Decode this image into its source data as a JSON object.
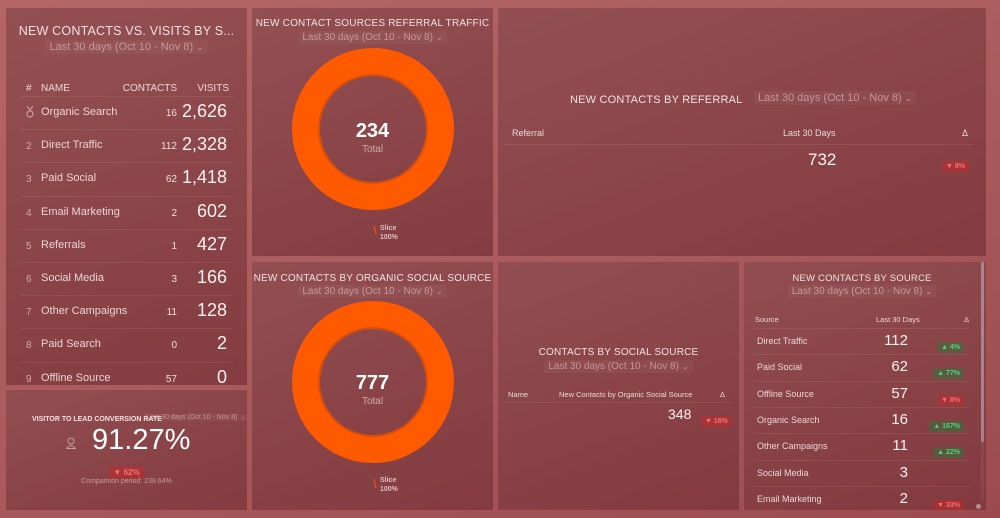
{
  "colors": {
    "background": "#b06262",
    "donut": "#ff5a00",
    "donut_inner": "#d94f08",
    "delta_down": "#ff6e6e",
    "delta_up": "#4cd47a"
  },
  "date_range": "Last 30 days (Oct 10 - Nov 8)",
  "contacts_vs_visits": {
    "title": "NEW CONTACTS VS. VISITS BY S...",
    "date_range": "Last 30 days (Oct 10 - Nov 8)",
    "columns": {
      "rank": "#",
      "name": "NAME",
      "contacts": "CONTACTS",
      "visits": "VISITS"
    },
    "rows": [
      {
        "rank": "medal-icon",
        "name": "Organic Search",
        "contacts": "16",
        "visits": "2,626"
      },
      {
        "rank": "2",
        "name": "Direct Traffic",
        "contacts": "112",
        "visits": "2,328"
      },
      {
        "rank": "3",
        "name": "Paid Social",
        "contacts": "62",
        "visits": "1,418"
      },
      {
        "rank": "4",
        "name": "Email Marketing",
        "contacts": "2",
        "visits": "602"
      },
      {
        "rank": "5",
        "name": "Referrals",
        "contacts": "1",
        "visits": "427"
      },
      {
        "rank": "6",
        "name": "Social Media",
        "contacts": "3",
        "visits": "166"
      },
      {
        "rank": "7",
        "name": "Other Campaigns",
        "contacts": "11",
        "visits": "128"
      },
      {
        "rank": "8",
        "name": "Paid Search",
        "contacts": "0",
        "visits": "2"
      },
      {
        "rank": "9",
        "name": "Offline Source",
        "contacts": "57",
        "visits": "0"
      }
    ]
  },
  "conversion_rate": {
    "title": "VISITOR TO LEAD CONVERSION RATE",
    "date_range": "Last 30 days (Oct 10 - Nov 8)",
    "icon": "user-icon",
    "value": "91.27%",
    "delta": "▼ 62%",
    "comparison": "Comparison period: 238.64%"
  },
  "referral_traffic": {
    "title": "NEW CONTACT SOURCES REFERRAL TRAFFIC",
    "date_range": "Last 30 days (Oct 10 - Nov 8)",
    "total": "234",
    "total_label": "Total",
    "slice_label": "Slice",
    "slice_pct": "100%",
    "slice_fraction": 1.0
  },
  "organic_social": {
    "title": "NEW CONTACTS BY ORGANIC SOCIAL SOURCE",
    "date_range": "Last 30 days (Oct 10 - Nov 8)",
    "total": "777",
    "total_label": "Total",
    "slice_label": "Slice",
    "slice_pct": "100%",
    "slice_fraction": 1.0
  },
  "by_referral": {
    "title": "NEW CONTACTS BY REFERRAL",
    "date_range": "Last 30 days (Oct 10 - Nov 8)",
    "columns": {
      "name": "Referral",
      "value": "Last 30 Days",
      "delta": "Δ"
    },
    "value": "732",
    "delta": "▼ 8%"
  },
  "by_social_source": {
    "title": "CONTACTS BY SOCIAL SOURCE",
    "date_range": "Last 30 days (Oct 10 - Nov 8)",
    "columns": {
      "name": "Name",
      "value": "New Contacts by Organic Social Source",
      "delta": "Δ"
    },
    "value": "348",
    "delta": "▼ 16%"
  },
  "by_source": {
    "title": "NEW CONTACTS BY SOURCE",
    "date_range": "Last 30 days (Oct 10 - Nov 8)",
    "columns": {
      "name": "Source",
      "value": "Last 30 Days",
      "delta": "Δ"
    },
    "rows": [
      {
        "name": "Direct Traffic",
        "value": "112",
        "delta": "▲ 4%",
        "dir": "up"
      },
      {
        "name": "Paid Social",
        "value": "62",
        "delta": "▲ 77%",
        "dir": "up"
      },
      {
        "name": "Offline Source",
        "value": "57",
        "delta": "▼ 8%",
        "dir": "down"
      },
      {
        "name": "Organic Search",
        "value": "16",
        "delta": "▲ 167%",
        "dir": "up"
      },
      {
        "name": "Other Campaigns",
        "value": "11",
        "delta": "▲ 22%",
        "dir": "up"
      },
      {
        "name": "Social Media",
        "value": "3",
        "delta": "",
        "dir": ""
      },
      {
        "name": "Email Marketing",
        "value": "2",
        "delta": "▼ 33%",
        "dir": "down"
      }
    ]
  }
}
